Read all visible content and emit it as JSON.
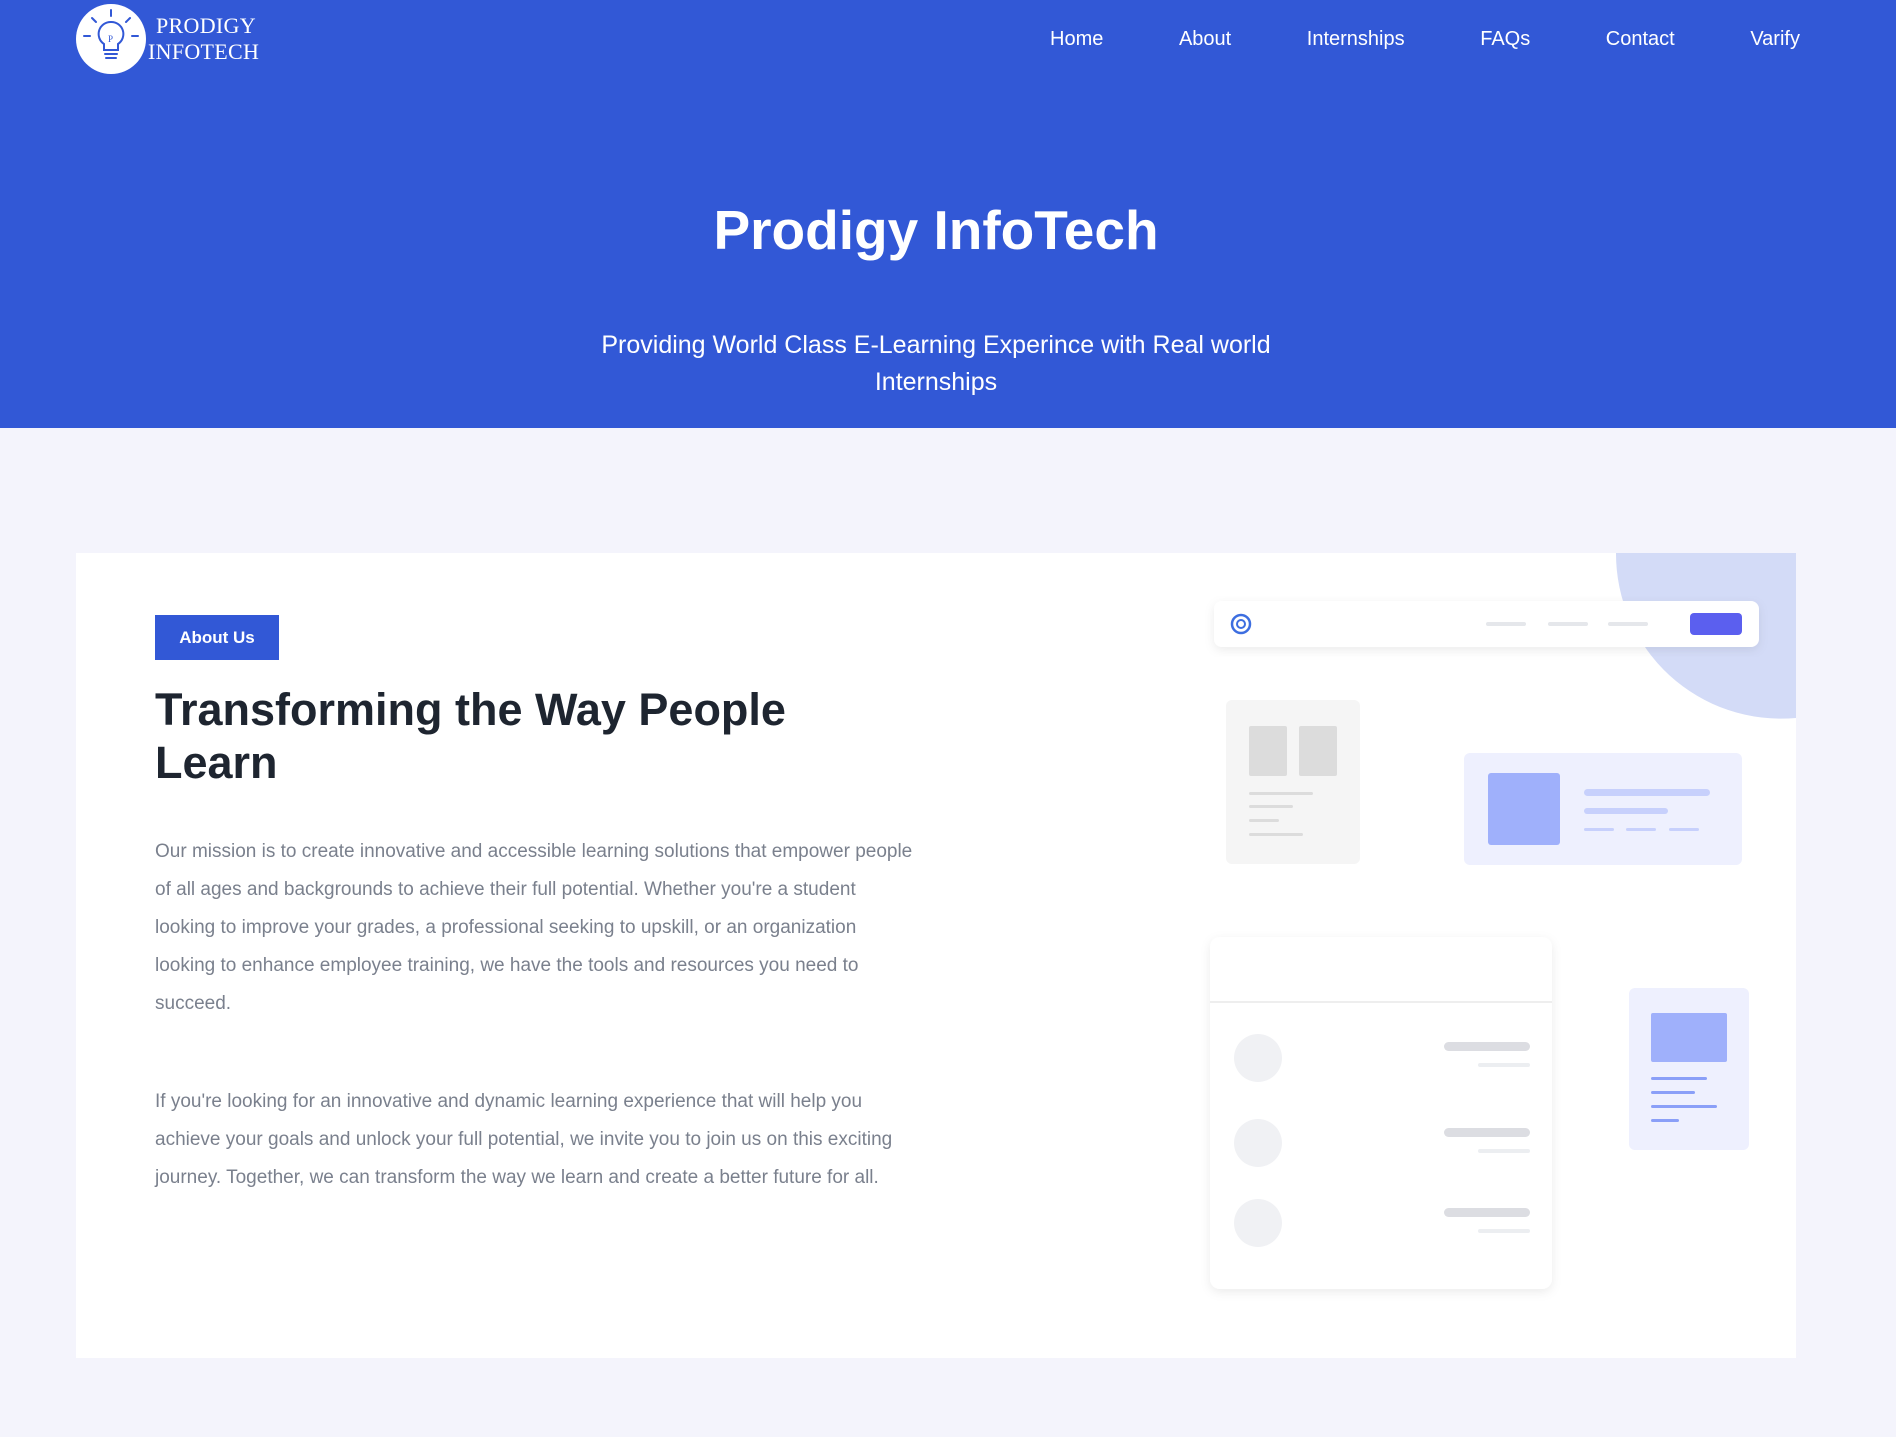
{
  "brand": {
    "line1": "PRODIGY",
    "line2": "INFOTECH",
    "logo_icon": "lightbulb-logo-icon"
  },
  "nav": {
    "items": [
      "Home",
      "About",
      "Internships",
      "FAQs",
      "Contact",
      "Varify"
    ]
  },
  "hero": {
    "title": "Prodigy InfoTech",
    "subtitle": "Providing World Class E-Learning Experince with Real world Internships"
  },
  "about": {
    "badge": "About Us",
    "title": "Transforming the Way People Learn",
    "paragraphs": [
      "Our mission is to create innovative and accessible learning solutions that empower people of all ages and backgrounds to achieve their full potential. Whether you're a student looking to improve your grades, a professional seeking to upskill, or an organization looking to enhance employee training, we have the tools and resources you need to succeed.",
      "If you're looking for an innovative and dynamic learning experience that will help you achieve your goals and unlock your full potential, we invite you to join us on this exciting journey. Together, we can transform the way we learn and create a better future for all."
    ]
  },
  "colors": {
    "primary": "#3258d6",
    "page_bg": "#f4f4fc",
    "heading": "#1e2530",
    "body_text": "#7a808d",
    "illustration_accent": "#9fb0fb",
    "illustration_button": "#5b5fef"
  }
}
